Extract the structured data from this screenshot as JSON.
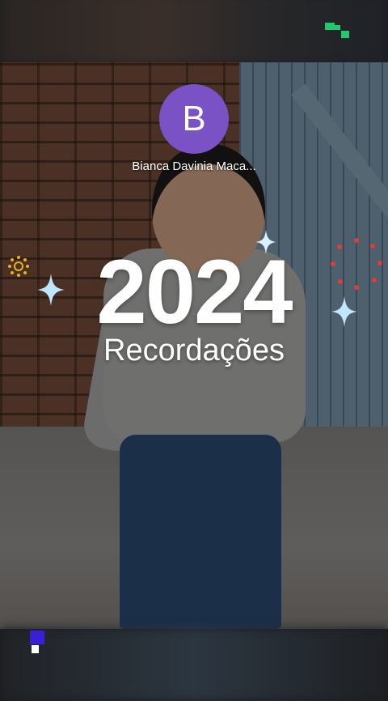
{
  "story": {
    "user": {
      "initial": "B",
      "name": "Bianca Davinia Maca..."
    },
    "title": "2024",
    "subtitle": "Recordações"
  },
  "colors": {
    "avatar_bg": "#7a52c6",
    "top_mark": "#21c96c",
    "bottom_mark": "#3a1fd6",
    "sparkle": "#bfe6ff",
    "deco_yellow": "#e8b21a",
    "deco_red": "#e23b3b"
  },
  "icons": {
    "top_right": "pixel-logo-icon",
    "bottom_left": "pixel-logo-icon",
    "sparkles": "sparkle-icon",
    "sun": "sun-burst-icon",
    "firework": "firework-dots-icon"
  }
}
